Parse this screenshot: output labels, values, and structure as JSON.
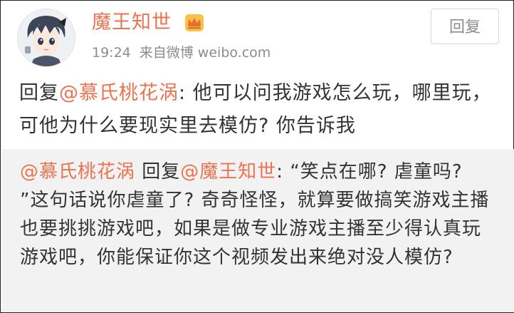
{
  "post": {
    "username": "魔王知世",
    "badge_icon": "crown-icon",
    "time": "19:24",
    "source": "来自微博 weibo.com",
    "reply_button": "回复"
  },
  "comment": {
    "prefix": "回复",
    "mention": "@慕氏桃花涡",
    "text": ": 他可以问我游戏怎么玩，哪里玩，可他为什么要现实里去模仿? 你告诉我"
  },
  "quoted": {
    "author": "@慕氏桃花涡",
    "reply_word": " 回复",
    "mention": "@魔王知世",
    "text": ": “笑点在哪? 虐童吗? ”这句话说你虐童了? 奇奇怪怪，就算要做搞笑游戏主播也要挑挑游戏吧，如果是做专业游戏主播至少得认真玩游戏吧，你能保证你这个视频发出来绝对没人模仿?"
  },
  "colors": {
    "accent": "#eb7350",
    "meta_text": "#8c8c8c",
    "body_text": "#333333",
    "quote_bg": "#f2f2f2"
  }
}
